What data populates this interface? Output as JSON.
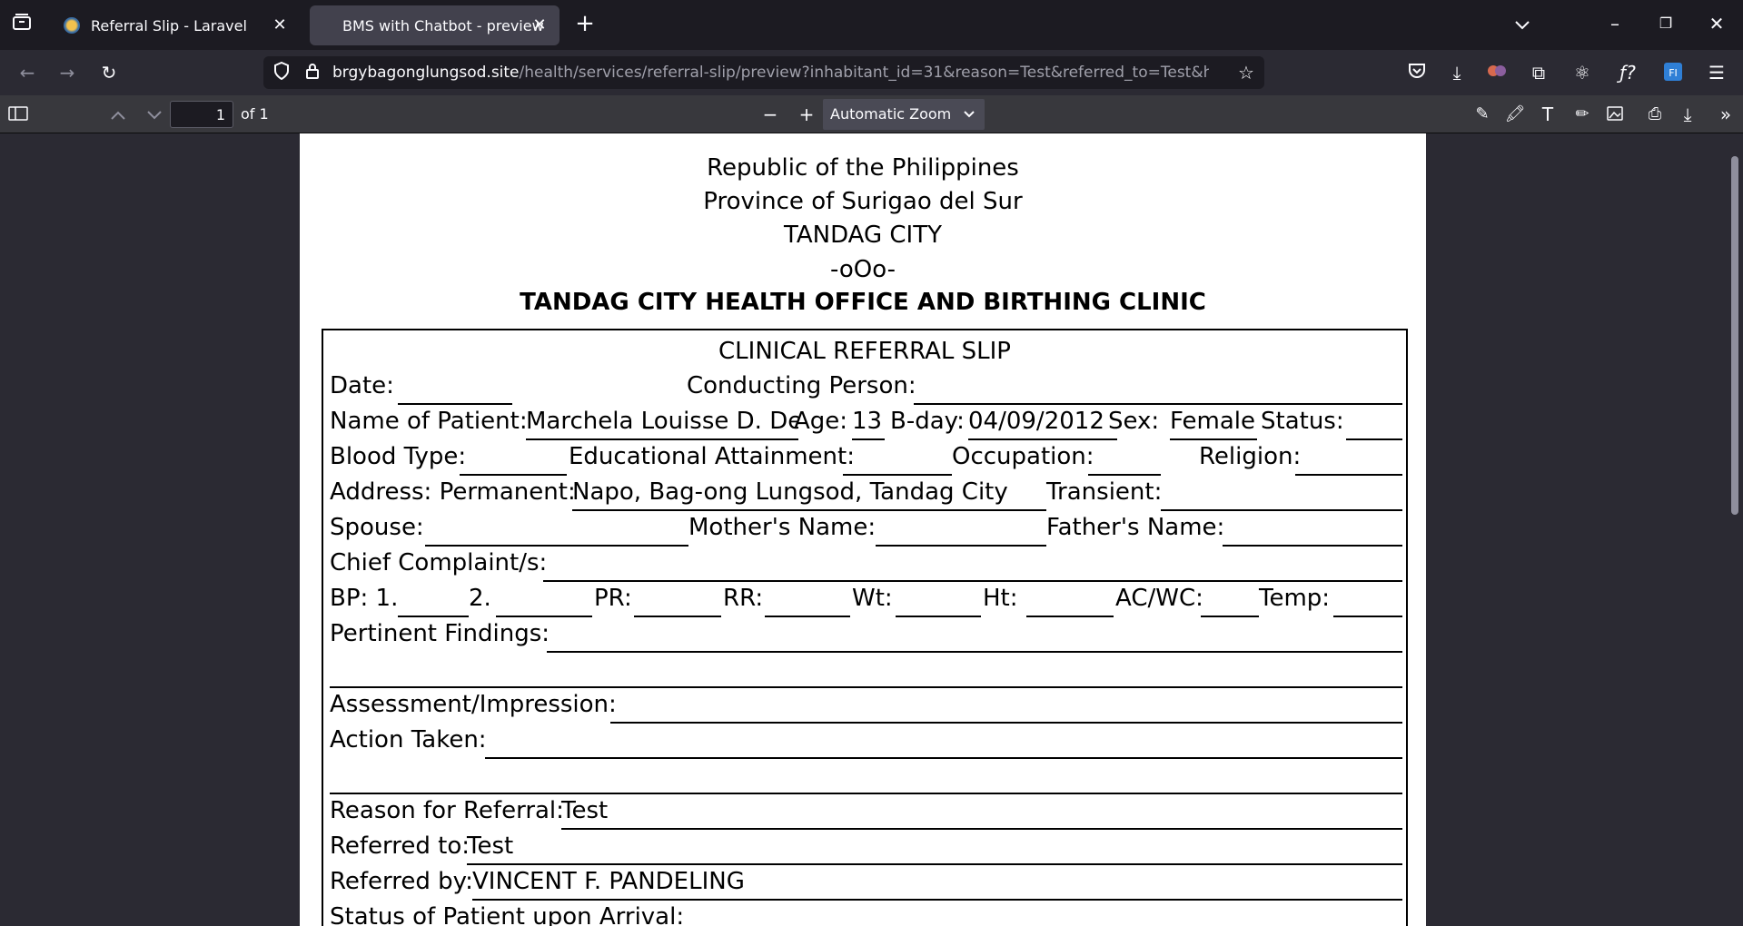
{
  "browser": {
    "tabs": [
      {
        "label": "Referral Slip - Laravel"
      },
      {
        "label": "BMS with Chatbot - preview"
      }
    ],
    "url": {
      "host": "brgybagonglungsod.site",
      "path": "/health/services/referral-slip/preview?inhabitant_id=31&reason=Test&referred_to=Test&health_o"
    }
  },
  "pdf_toolbar": {
    "page_number": "1",
    "page_total": "of 1",
    "zoom": "Automatic Zoom"
  },
  "document": {
    "header": [
      "Republic of the Philippines",
      "Province of Surigao del Sur",
      "TANDAG CITY",
      "-oOo-"
    ],
    "office": "TANDAG CITY HEALTH OFFICE AND BIRTHING CLINIC",
    "form_title": "CLINICAL REFERRAL SLIP",
    "labels": {
      "date": "Date:",
      "conducting": "Conducting Person:",
      "patient": "Name of Patient:",
      "age": "Age:",
      "bday": "B-day:",
      "sex": "Sex:",
      "status": "Status:",
      "blood": "Blood Type:",
      "edu": "Educational Attainment:",
      "occupation": "Occupation:",
      "religion": "Religion:",
      "address": "Address: Permanent:",
      "transient": "Transient:",
      "spouse": "Spouse:",
      "mother": "Mother's Name:",
      "father": "Father's Name:",
      "complaint": "Chief Complaint/s:",
      "bp1": "BP: 1.",
      "bp2": "2.",
      "pr": "PR:",
      "rr": "RR:",
      "wt": "Wt:",
      "ht": "Ht:",
      "acwc": "AC/WC:",
      "temp": "Temp:",
      "findings": "Pertinent Findings:",
      "assessment": "Assessment/Impression:",
      "action": "Action Taken:",
      "reason": "Reason for Referral:",
      "referred_to": "Referred to:",
      "referred_by": "Referred by:",
      "arrival": "Status of Patient upon Arrival:"
    },
    "values": {
      "patient": "Marchela Louisse D. Dec",
      "age": "13",
      "bday": "04/09/2012",
      "sex": "Female",
      "address": "Napo, Bag-ong Lungsod, Tandag City",
      "reason": "Test",
      "referred_to": "Test",
      "referred_by": "VINCENT F. PANDELING"
    }
  }
}
